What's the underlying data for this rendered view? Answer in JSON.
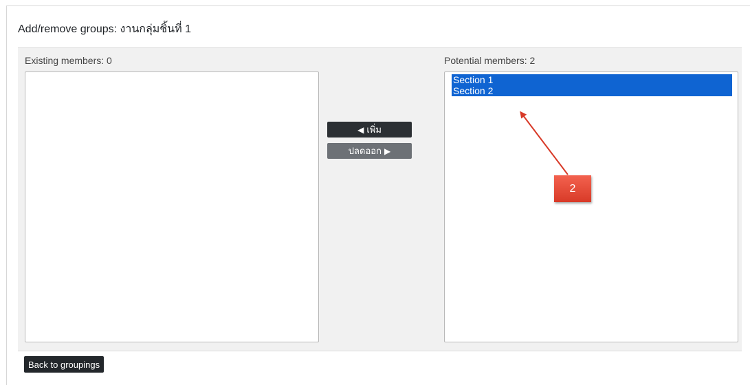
{
  "page": {
    "title": "Add/remove groups: งานกลุ่มชิ้นที่ 1"
  },
  "existing": {
    "label": "Existing members: 0",
    "items": []
  },
  "potential": {
    "label": "Potential members: 2",
    "items": [
      "Section 1",
      "Section 2"
    ]
  },
  "actions": {
    "add_label": "เพิ่ม",
    "remove_label": "ปลดออก",
    "back_label": "Back to groupings"
  },
  "annotation": {
    "badge_text": "2",
    "color": "#d83a28"
  },
  "colors": {
    "selection": "#0f64d2",
    "add_button": "#2b2f33",
    "remove_button": "#6d7176"
  }
}
